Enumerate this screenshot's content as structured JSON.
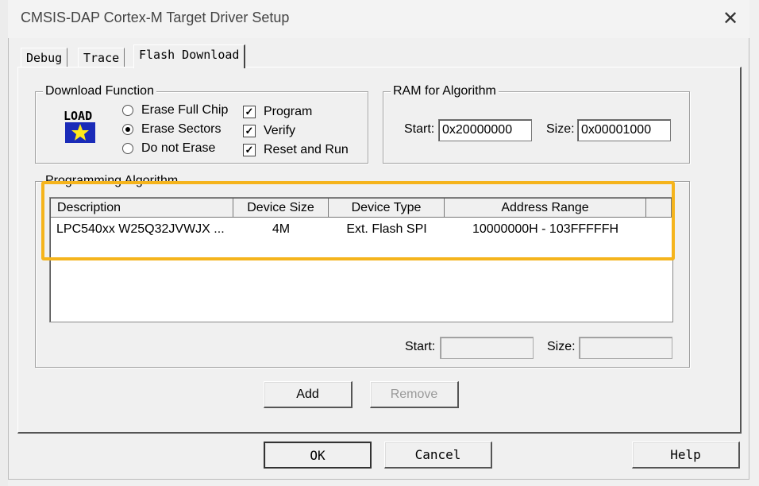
{
  "window": {
    "title": "CMSIS-DAP Cortex-M Target Driver Setup"
  },
  "tabs": [
    {
      "label": "Debug"
    },
    {
      "label": "Trace"
    },
    {
      "label": "Flash Download"
    }
  ],
  "download_function": {
    "label": "Download Function",
    "icon_label": "LOAD",
    "erase_options": [
      {
        "label": "Erase Full Chip",
        "selected": false
      },
      {
        "label": "Erase Sectors",
        "selected": true
      },
      {
        "label": "Do not Erase",
        "selected": false
      }
    ],
    "checks": [
      {
        "label": "Program",
        "checked": true
      },
      {
        "label": "Verify",
        "checked": true
      },
      {
        "label": "Reset and Run",
        "checked": true
      }
    ]
  },
  "ram": {
    "label": "RAM for Algorithm",
    "start_label": "Start:",
    "start_value": "0x20000000",
    "size_label": "Size:",
    "size_value": "0x00001000"
  },
  "programming": {
    "label": "Programming Algorithm",
    "columns": [
      "Description",
      "Device Size",
      "Device Type",
      "Address Range"
    ],
    "rows": [
      {
        "description": "LPC540xx W25Q32JVWJX ...",
        "device_size": "4M",
        "device_type": "Ext. Flash SPI",
        "address_range": "10000000H - 103FFFFFH"
      }
    ],
    "start_label": "Start:",
    "start_value": "",
    "size_label": "Size:",
    "size_value": ""
  },
  "buttons": {
    "add": "Add",
    "remove": "Remove",
    "ok": "OK",
    "cancel": "Cancel",
    "help": "Help"
  },
  "colors": {
    "highlight": "#f5b41c"
  }
}
